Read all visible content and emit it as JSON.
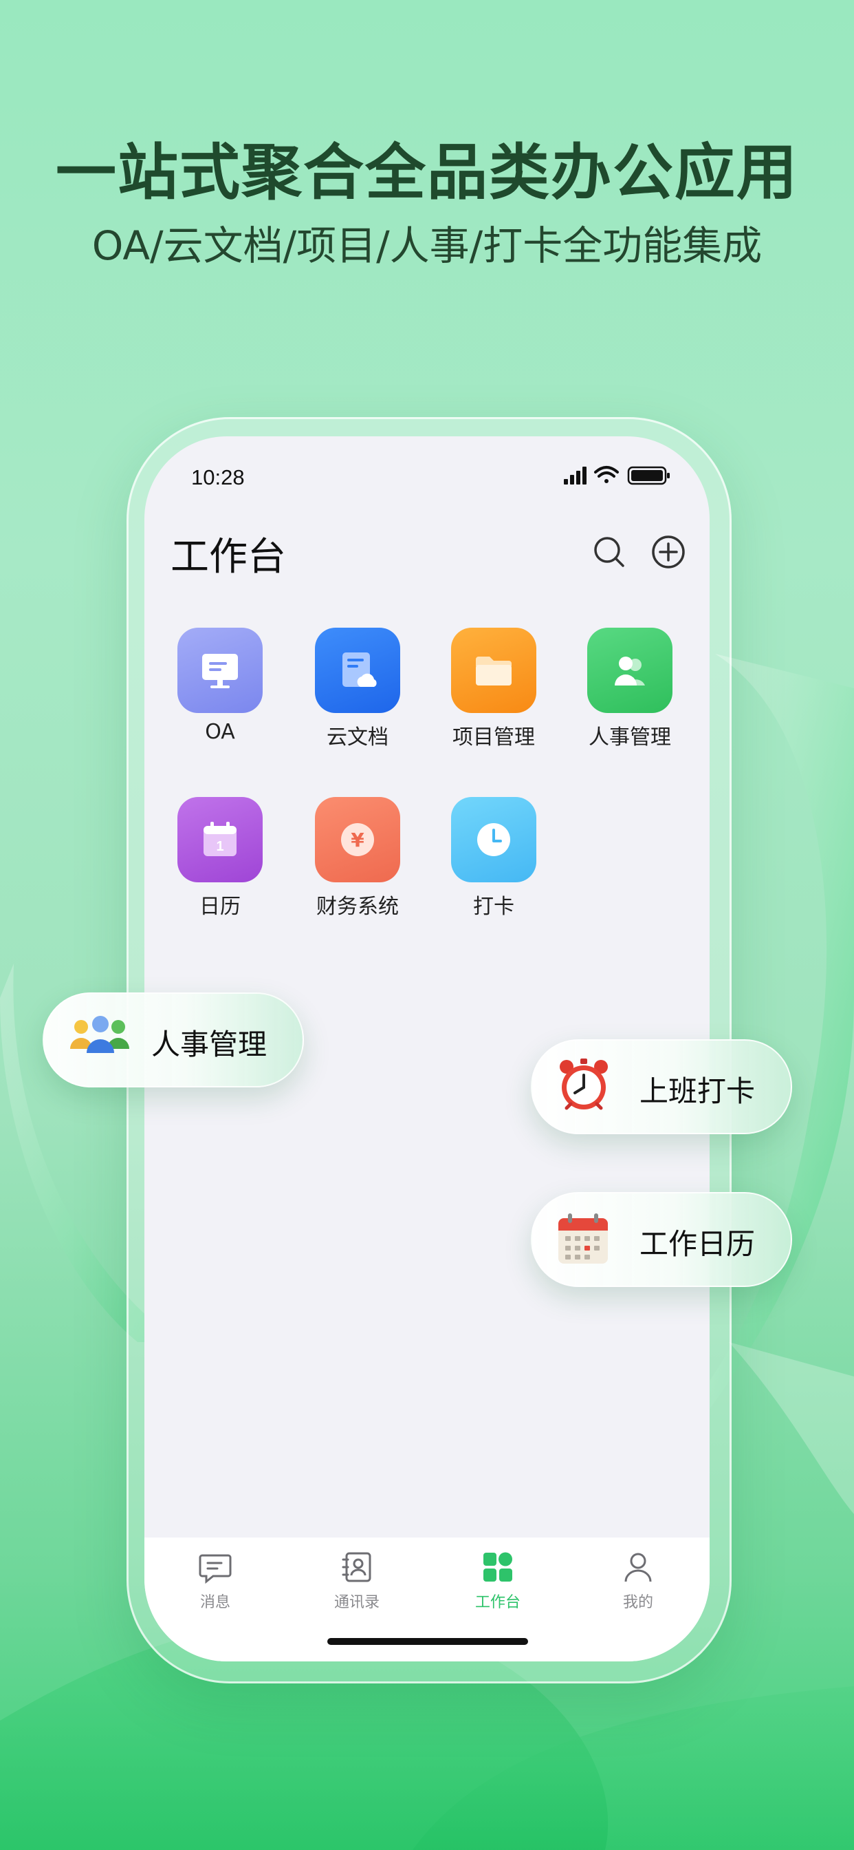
{
  "hero": {
    "title": "一站式聚合全品类办公应用",
    "subtitle": "OA/云文档/项目/人事/打卡全功能集成"
  },
  "status_bar": {
    "time": "10:28"
  },
  "header": {
    "title": "工作台",
    "search_icon": "search-icon",
    "add_icon": "plus-circle-icon"
  },
  "apps": [
    {
      "label": "OA",
      "icon": "presentation-board-icon",
      "color": "#8b97f2"
    },
    {
      "label": "云文档",
      "icon": "cloud-document-icon",
      "color": "#2f7cf6"
    },
    {
      "label": "项目管理",
      "icon": "folder-icon",
      "color": "#f99a22"
    },
    {
      "label": "人事管理",
      "icon": "people-icon",
      "color": "#3ec96a"
    },
    {
      "label": "日历",
      "icon": "calendar-icon",
      "color": "#b25ae0"
    },
    {
      "label": "财务系统",
      "icon": "yen-coin-icon",
      "color": "#f57a5e"
    },
    {
      "label": "打卡",
      "icon": "clock-icon",
      "color": "#5bc8f8"
    }
  ],
  "tabbar": {
    "items": [
      {
        "label": "消息",
        "icon": "chat-bubble-icon"
      },
      {
        "label": "通讯录",
        "icon": "contacts-book-icon"
      },
      {
        "label": "工作台",
        "icon": "grid-apps-icon"
      },
      {
        "label": "我的",
        "icon": "user-icon"
      }
    ],
    "active": "工作台",
    "accent": "#2ec36a"
  },
  "floating": {
    "hr": {
      "label": "人事管理",
      "icon": "group-people-icon"
    },
    "clock_in": {
      "label": "上班打卡",
      "icon": "alarm-clock-icon"
    },
    "calendar": {
      "label": "工作日历",
      "icon": "calendar-icon"
    }
  }
}
